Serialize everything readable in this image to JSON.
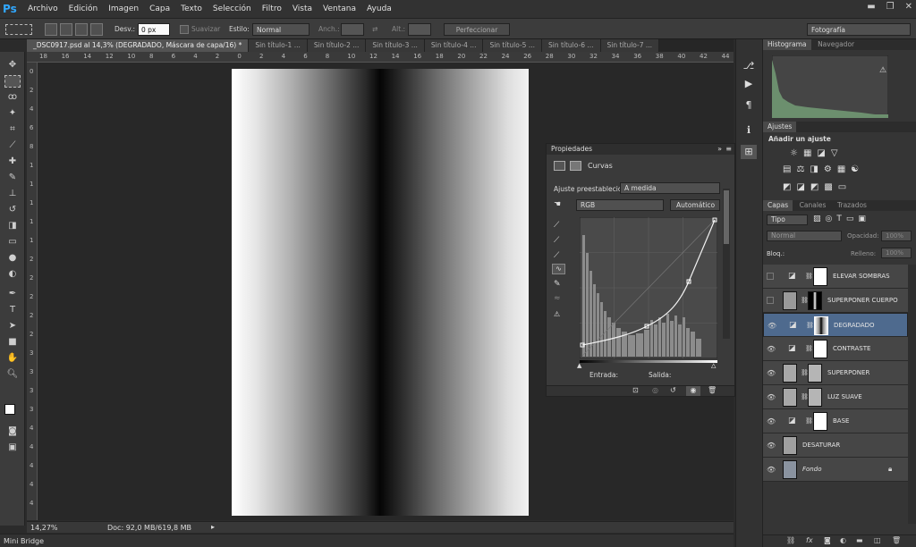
{
  "app": {
    "logo": "Ps",
    "accent": "#31a8ff"
  },
  "menu": [
    "Archivo",
    "Edición",
    "Imagen",
    "Capa",
    "Texto",
    "Selección",
    "Filtro",
    "Vista",
    "Ventana",
    "Ayuda"
  ],
  "options": {
    "feather_label": "Desv.:",
    "feather_value": "0 px",
    "antialias_label": "Suavizar",
    "style_label": "Estilo:",
    "style_value": "Normal",
    "width_label": "Anch.:",
    "height_label": "Alt.:",
    "refine_label": "Perfeccionar bor.",
    "workspace": "Fotografía"
  },
  "doc_tabs": [
    "_DSC0917.psd al 14,3% (DEGRADADO, Máscara de capa/16) *",
    "Sin título-1 ...",
    "Sin título-2 ...",
    "Sin título-3 ...",
    "Sin título-4 ...",
    "Sin título-5 ...",
    "Sin título-6 ...",
    "Sin título-7 ..."
  ],
  "ruler_top": [
    "18",
    "16",
    "14",
    "12",
    "10",
    "8",
    "6",
    "4",
    "2",
    "0",
    "2",
    "4",
    "6",
    "8",
    "10",
    "12",
    "14",
    "16",
    "18",
    "20",
    "22",
    "24",
    "26",
    "28",
    "30",
    "32",
    "34",
    "36",
    "38",
    "40",
    "42",
    "44"
  ],
  "ruler_left": [
    "0",
    "2",
    "4",
    "6",
    "8",
    "1",
    "1",
    "1",
    "1",
    "1",
    "2",
    "2",
    "2",
    "2",
    "2",
    "3",
    "3",
    "3",
    "3",
    "4",
    "4",
    "4",
    "4",
    "4"
  ],
  "status": {
    "zoom": "14,27%",
    "doc": "Doc: 92,0 MB/619,8 MB"
  },
  "mini_bridge": "Mini Bridge",
  "properties": {
    "title": "Propiedades",
    "mode": "Curvas",
    "preset_label": "Ajuste preestablecido:",
    "preset_value": "A medida",
    "channel": "RGB",
    "auto_label": "Automático",
    "input_label": "Entrada:",
    "output_label": "Salida:"
  },
  "histogram_tabs": [
    "Histograma",
    "Navegador"
  ],
  "adjustments": {
    "tab": "Ajustes",
    "add_label": "Añadir un ajuste"
  },
  "layers_panel": {
    "tabs": [
      "Capas",
      "Canales",
      "Trazados"
    ],
    "filter": "Tipo",
    "blend": "Normal",
    "opacity_label": "Opacidad:",
    "opacity_value": "100%",
    "lock_label": "Bloq.:",
    "fill_label": "Relleno:",
    "fill_value": "100%"
  },
  "layers": [
    {
      "name": "ELEVAR SOMBRAS",
      "visible": false,
      "type": "curves"
    },
    {
      "name": "SUPERPONER CUERPO",
      "visible": false,
      "type": "photo-mask"
    },
    {
      "name": "DEGRADADO",
      "visible": true,
      "type": "curves",
      "selected": true
    },
    {
      "name": "CONTRASTE",
      "visible": true,
      "type": "curves"
    },
    {
      "name": "SUPERPONER",
      "visible": true,
      "type": "photo-mask"
    },
    {
      "name": "LUZ SUAVE",
      "visible": true,
      "type": "photo-mask"
    },
    {
      "name": "BASE",
      "visible": true,
      "type": "curves"
    },
    {
      "name": "DESATURAR",
      "visible": true,
      "type": "photo"
    },
    {
      "name": "Fondo",
      "visible": true,
      "type": "photo-lock"
    }
  ]
}
